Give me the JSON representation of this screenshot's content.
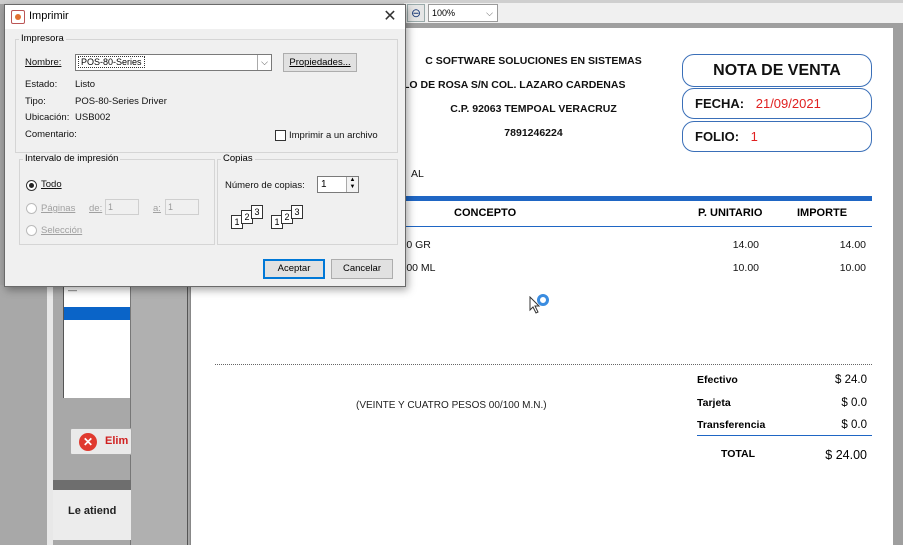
{
  "viewer": {
    "zoom_value": "100%",
    "zoom_icon": "zoom-out-icon"
  },
  "app": {
    "delete_button_label": "Elim",
    "attending_label": "Le atiend"
  },
  "receipt": {
    "company_line1": "C SOFTWARE SOLUCIONES EN SISTEMAS",
    "company_line2": "LO DE ROSA S/N COL. LAZARO CARDENAS",
    "company_line3": "C.P. 92063 TEMPOAL VERACRUZ",
    "company_phone": "7891246224",
    "doc_title": "NOTA DE VENTA",
    "fecha_label": "FECHA:",
    "fecha_value": "21/09/2021",
    "folio_label": "FOLIO:",
    "folio_value": "1",
    "client_fragment": "AL",
    "col_concepto": "CONCEPTO",
    "col_unitario": "P. UNITARIO",
    "col_importe": "IMPORTE",
    "items": [
      {
        "concepto": "i0 GR",
        "unitario": "14.00",
        "importe": "14.00"
      },
      {
        "concepto": "i00 ML",
        "unitario": "10.00",
        "importe": "10.00"
      }
    ],
    "amount_words": "(VEINTE Y CUATRO PESOS 00/100 M.N.)",
    "efectivo_label": "Efectivo",
    "efectivo_value": "$ 24.0",
    "tarjeta_label": "Tarjeta",
    "tarjeta_value": "$ 0.0",
    "transferencia_label": "Transferencia",
    "transferencia_value": "$ 0.0",
    "total_label": "TOTAL",
    "total_value": "$ 24.00"
  },
  "dialog": {
    "title": "Imprimir",
    "close_glyph": "✕",
    "printer_group": "Impresora",
    "name_label": "Nombre:",
    "printer_name": "POS-80-Series",
    "properties_button": "Propiedades...",
    "status_label": "Estado:",
    "status_value": "Listo",
    "type_label": "Tipo:",
    "type_value": "POS-80-Series Driver",
    "location_label": "Ubicación:",
    "location_value": "USB002",
    "comment_label": "Comentario:",
    "print_to_file_label": "Imprimir a un archivo",
    "range_group": "Intervalo de impresión",
    "all_label": "Todo",
    "pages_label": "Páginas",
    "from_label": "de:",
    "from_value": "1",
    "to_label": "a:",
    "to_value": "1",
    "selection_label": "Selección",
    "copies_group": "Copias",
    "copies_label": "Número de copias:",
    "copies_value": "1",
    "ok_button": "Aceptar",
    "cancel_button": "Cancelar"
  }
}
